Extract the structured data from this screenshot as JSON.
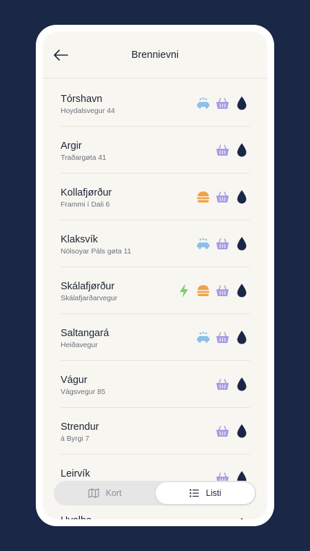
{
  "header": {
    "title": "Brennievni"
  },
  "stations": [
    {
      "name": "Tórshavn",
      "address": "Hoydalsvegur 44",
      "amenities": [
        "car-wash",
        "shop-basket",
        "fuel-drop"
      ]
    },
    {
      "name": "Argir",
      "address": "Traðargøta 41",
      "amenities": [
        "shop-basket",
        "fuel-drop"
      ]
    },
    {
      "name": "Kollafjørður",
      "address": "Frammi í Dali 6",
      "amenities": [
        "burger",
        "shop-basket",
        "fuel-drop"
      ]
    },
    {
      "name": "Klaksvík",
      "address": "Nólsoyar Páls gøta 11",
      "amenities": [
        "car-wash",
        "shop-basket",
        "fuel-drop"
      ]
    },
    {
      "name": "Skálafjørður",
      "address": "Skálafjarðarvegur",
      "amenities": [
        "ev-charging",
        "burger",
        "shop-basket",
        "fuel-drop"
      ]
    },
    {
      "name": "Saltangará",
      "address": "Heiðavegur",
      "amenities": [
        "car-wash",
        "shop-basket",
        "fuel-drop"
      ]
    },
    {
      "name": "Vágur",
      "address": "Vágsvegur 85",
      "amenities": [
        "shop-basket",
        "fuel-drop"
      ]
    },
    {
      "name": "Strendur",
      "address": "á Byrgi 7",
      "amenities": [
        "shop-basket",
        "fuel-drop"
      ]
    },
    {
      "name": "Leirvík",
      "address": "",
      "amenities": [
        "shop-basket",
        "fuel-drop"
      ]
    },
    {
      "name": "Hvalba",
      "address": "",
      "amenities": [
        "fuel-drop"
      ]
    }
  ],
  "view_toggle": {
    "map_label": "Kort",
    "list_label": "Listi",
    "selected": "list"
  },
  "colors": {
    "background": "#1a2746",
    "screen": "#f8f6f1",
    "fuel": "#1a2746",
    "shop": "#a79ae6",
    "wash": "#8fbfe8",
    "food": "#f0a24a",
    "ev": "#7ad06b"
  }
}
